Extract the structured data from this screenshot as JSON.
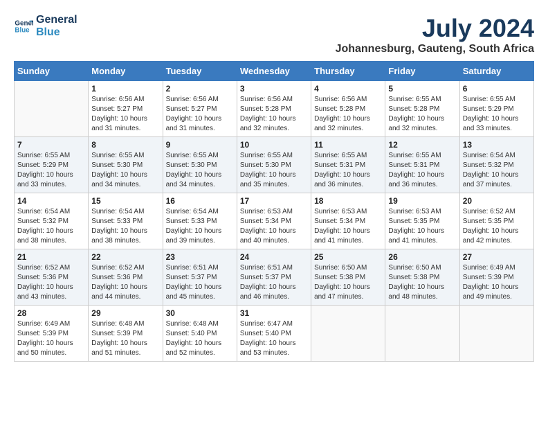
{
  "logo": {
    "line1": "General",
    "line2": "Blue"
  },
  "title": "July 2024",
  "subtitle": "Johannesburg, Gauteng, South Africa",
  "days_of_week": [
    "Sunday",
    "Monday",
    "Tuesday",
    "Wednesday",
    "Thursday",
    "Friday",
    "Saturday"
  ],
  "weeks": [
    [
      {
        "day": null,
        "sunrise": null,
        "sunset": null,
        "daylight": null
      },
      {
        "day": "1",
        "sunrise": "6:56 AM",
        "sunset": "5:27 PM",
        "daylight": "10 hours and 31 minutes."
      },
      {
        "day": "2",
        "sunrise": "6:56 AM",
        "sunset": "5:27 PM",
        "daylight": "10 hours and 31 minutes."
      },
      {
        "day": "3",
        "sunrise": "6:56 AM",
        "sunset": "5:28 PM",
        "daylight": "10 hours and 32 minutes."
      },
      {
        "day": "4",
        "sunrise": "6:56 AM",
        "sunset": "5:28 PM",
        "daylight": "10 hours and 32 minutes."
      },
      {
        "day": "5",
        "sunrise": "6:55 AM",
        "sunset": "5:28 PM",
        "daylight": "10 hours and 32 minutes."
      },
      {
        "day": "6",
        "sunrise": "6:55 AM",
        "sunset": "5:29 PM",
        "daylight": "10 hours and 33 minutes."
      }
    ],
    [
      {
        "day": "7",
        "sunrise": "6:55 AM",
        "sunset": "5:29 PM",
        "daylight": "10 hours and 33 minutes."
      },
      {
        "day": "8",
        "sunrise": "6:55 AM",
        "sunset": "5:30 PM",
        "daylight": "10 hours and 34 minutes."
      },
      {
        "day": "9",
        "sunrise": "6:55 AM",
        "sunset": "5:30 PM",
        "daylight": "10 hours and 34 minutes."
      },
      {
        "day": "10",
        "sunrise": "6:55 AM",
        "sunset": "5:30 PM",
        "daylight": "10 hours and 35 minutes."
      },
      {
        "day": "11",
        "sunrise": "6:55 AM",
        "sunset": "5:31 PM",
        "daylight": "10 hours and 36 minutes."
      },
      {
        "day": "12",
        "sunrise": "6:55 AM",
        "sunset": "5:31 PM",
        "daylight": "10 hours and 36 minutes."
      },
      {
        "day": "13",
        "sunrise": "6:54 AM",
        "sunset": "5:32 PM",
        "daylight": "10 hours and 37 minutes."
      }
    ],
    [
      {
        "day": "14",
        "sunrise": "6:54 AM",
        "sunset": "5:32 PM",
        "daylight": "10 hours and 38 minutes."
      },
      {
        "day": "15",
        "sunrise": "6:54 AM",
        "sunset": "5:33 PM",
        "daylight": "10 hours and 38 minutes."
      },
      {
        "day": "16",
        "sunrise": "6:54 AM",
        "sunset": "5:33 PM",
        "daylight": "10 hours and 39 minutes."
      },
      {
        "day": "17",
        "sunrise": "6:53 AM",
        "sunset": "5:34 PM",
        "daylight": "10 hours and 40 minutes."
      },
      {
        "day": "18",
        "sunrise": "6:53 AM",
        "sunset": "5:34 PM",
        "daylight": "10 hours and 41 minutes."
      },
      {
        "day": "19",
        "sunrise": "6:53 AM",
        "sunset": "5:35 PM",
        "daylight": "10 hours and 41 minutes."
      },
      {
        "day": "20",
        "sunrise": "6:52 AM",
        "sunset": "5:35 PM",
        "daylight": "10 hours and 42 minutes."
      }
    ],
    [
      {
        "day": "21",
        "sunrise": "6:52 AM",
        "sunset": "5:36 PM",
        "daylight": "10 hours and 43 minutes."
      },
      {
        "day": "22",
        "sunrise": "6:52 AM",
        "sunset": "5:36 PM",
        "daylight": "10 hours and 44 minutes."
      },
      {
        "day": "23",
        "sunrise": "6:51 AM",
        "sunset": "5:37 PM",
        "daylight": "10 hours and 45 minutes."
      },
      {
        "day": "24",
        "sunrise": "6:51 AM",
        "sunset": "5:37 PM",
        "daylight": "10 hours and 46 minutes."
      },
      {
        "day": "25",
        "sunrise": "6:50 AM",
        "sunset": "5:38 PM",
        "daylight": "10 hours and 47 minutes."
      },
      {
        "day": "26",
        "sunrise": "6:50 AM",
        "sunset": "5:38 PM",
        "daylight": "10 hours and 48 minutes."
      },
      {
        "day": "27",
        "sunrise": "6:49 AM",
        "sunset": "5:39 PM",
        "daylight": "10 hours and 49 minutes."
      }
    ],
    [
      {
        "day": "28",
        "sunrise": "6:49 AM",
        "sunset": "5:39 PM",
        "daylight": "10 hours and 50 minutes."
      },
      {
        "day": "29",
        "sunrise": "6:48 AM",
        "sunset": "5:39 PM",
        "daylight": "10 hours and 51 minutes."
      },
      {
        "day": "30",
        "sunrise": "6:48 AM",
        "sunset": "5:40 PM",
        "daylight": "10 hours and 52 minutes."
      },
      {
        "day": "31",
        "sunrise": "6:47 AM",
        "sunset": "5:40 PM",
        "daylight": "10 hours and 53 minutes."
      },
      {
        "day": null,
        "sunrise": null,
        "sunset": null,
        "daylight": null
      },
      {
        "day": null,
        "sunrise": null,
        "sunset": null,
        "daylight": null
      },
      {
        "day": null,
        "sunrise": null,
        "sunset": null,
        "daylight": null
      }
    ]
  ],
  "labels": {
    "sunrise": "Sunrise:",
    "sunset": "Sunset:",
    "daylight": "Daylight:"
  }
}
